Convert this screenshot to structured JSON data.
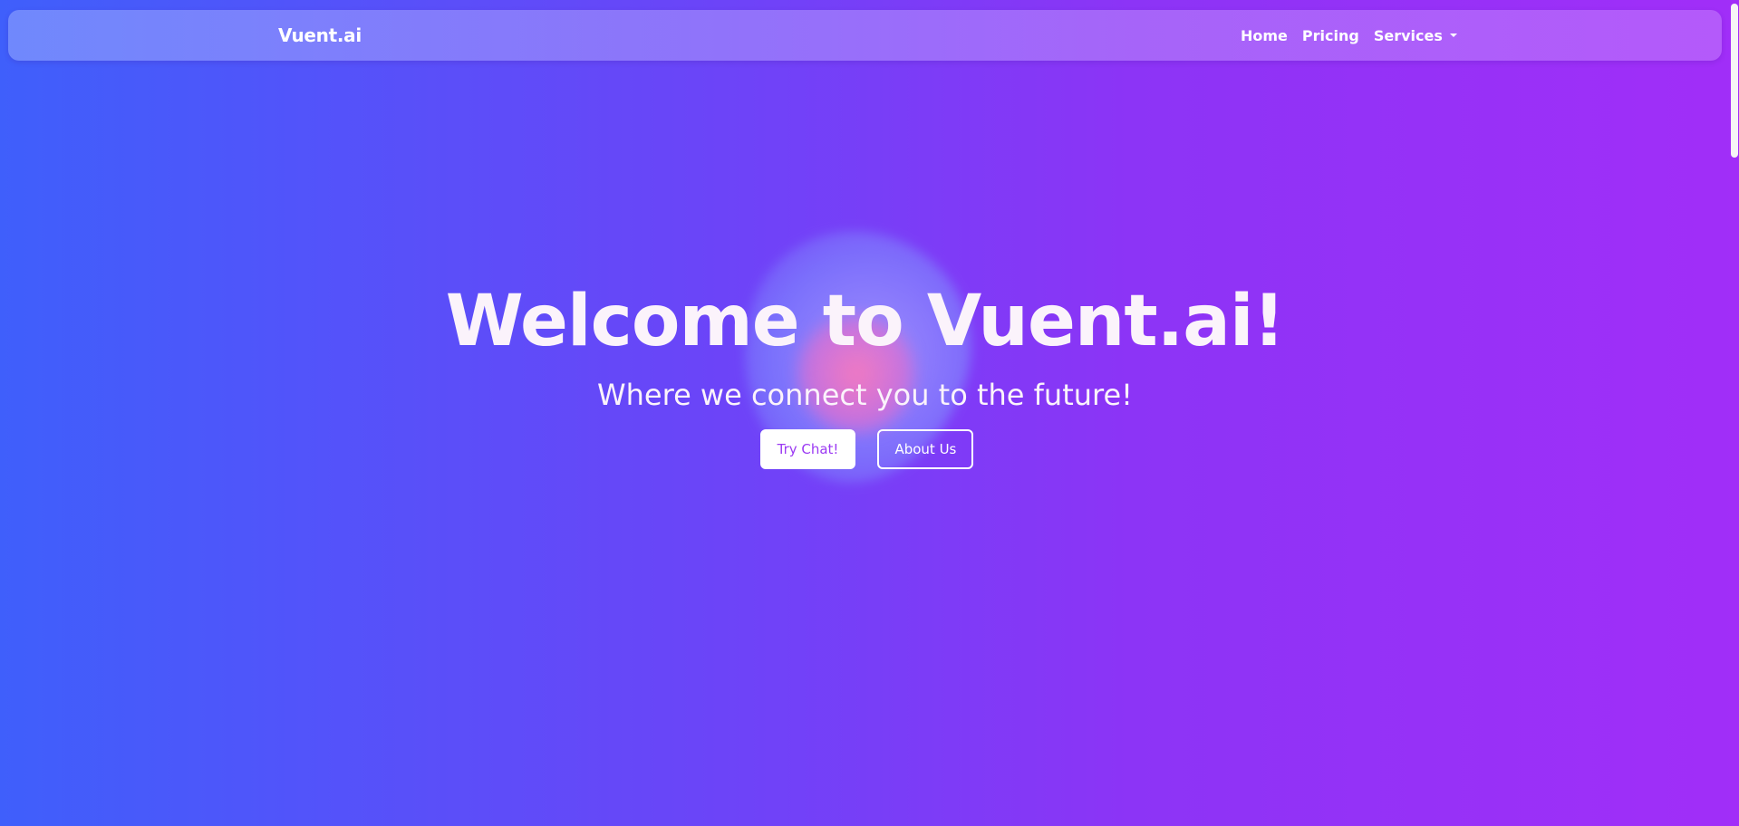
{
  "navbar": {
    "brand": "Vuent.ai",
    "links": [
      {
        "label": "Home"
      },
      {
        "label": "Pricing"
      },
      {
        "label": "Services"
      }
    ]
  },
  "hero": {
    "title": "Welcome to Vuent.ai!",
    "subtitle": "Where we connect you to the future!",
    "primary_button": "Try Chat!",
    "secondary_button": "About Us"
  },
  "colors": {
    "gradient_start": "#3f5ffb",
    "gradient_end": "#a12ef8",
    "primary_button_text": "#9b3af3"
  },
  "icons": {
    "services_dropdown": "chevron-down-icon"
  }
}
